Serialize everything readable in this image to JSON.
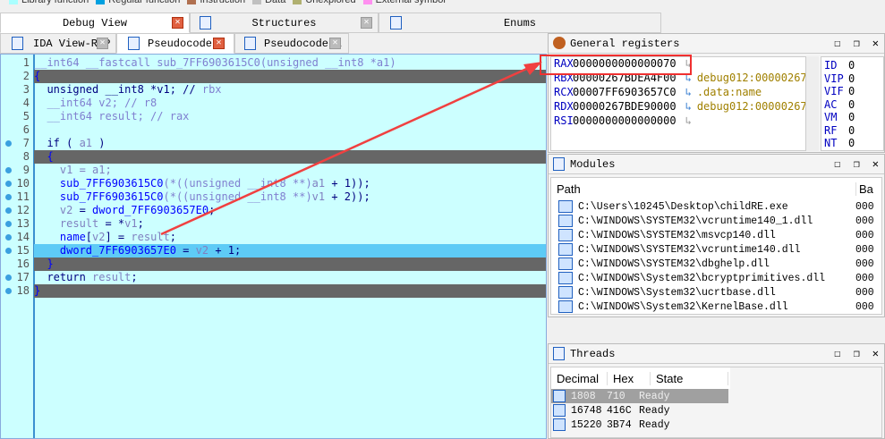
{
  "legend": [
    {
      "label": "Library function",
      "color": "#aaffff"
    },
    {
      "label": "Regular function",
      "color": "#00a0e0"
    },
    {
      "label": "Instruction",
      "color": "#b07050"
    },
    {
      "label": "Data",
      "color": "#c0c0c0"
    },
    {
      "label": "Unexplored",
      "color": "#b0b070"
    },
    {
      "label": "External symbol",
      "color": "#ff90f0"
    }
  ],
  "top_tabs": [
    {
      "label": "Debug View"
    },
    {
      "label": "Structures"
    },
    {
      "label": "Enums"
    }
  ],
  "sub_tabs": [
    {
      "label": "IDA View-RIP"
    },
    {
      "label": "Pseudocode-B"
    },
    {
      "label": "Pseudocode-A"
    }
  ],
  "code": [
    {
      "n": "1",
      "dot": false,
      "style": "",
      "seg": [
        [
          "__int64 __fastcall sub_7FF6903615C0(unsigned __int8 *a1)",
          "c"
        ]
      ]
    },
    {
      "n": "2",
      "dot": false,
      "style": "dark",
      "seg": [
        [
          "{",
          "f"
        ]
      ]
    },
    {
      "n": "3",
      "dot": false,
      "style": "",
      "seg": [
        [
          "  unsigned __int8 *v1; // ",
          "k"
        ],
        [
          "rbx",
          "c"
        ]
      ]
    },
    {
      "n": "4",
      "dot": false,
      "style": "",
      "seg": [
        [
          "  __int64 v2; // ",
          "c"
        ],
        [
          "r8",
          "c"
        ]
      ]
    },
    {
      "n": "5",
      "dot": false,
      "style": "",
      "seg": [
        [
          "  __int64 result; // ",
          "c"
        ],
        [
          "rax",
          "c"
        ]
      ]
    },
    {
      "n": "6",
      "dot": false,
      "style": "",
      "seg": [
        [
          "",
          "p"
        ]
      ]
    },
    {
      "n": "7",
      "dot": true,
      "style": "",
      "seg": [
        [
          "  if ( ",
          "k"
        ],
        [
          "a1",
          "v"
        ],
        [
          " )",
          "k"
        ]
      ]
    },
    {
      "n": "8",
      "dot": false,
      "style": "dark",
      "seg": [
        [
          "  {",
          "f"
        ]
      ]
    },
    {
      "n": "9",
      "dot": true,
      "style": "",
      "seg": [
        [
          "    v1 = a1;",
          "v"
        ]
      ]
    },
    {
      "n": "10",
      "dot": true,
      "style": "",
      "seg": [
        [
          "    sub_7FF6903615C0",
          "f"
        ],
        [
          "(*((unsigned __int8 **)",
          "c"
        ],
        [
          "a1",
          "v"
        ],
        [
          " + 1));",
          "k"
        ]
      ]
    },
    {
      "n": "11",
      "dot": true,
      "style": "",
      "seg": [
        [
          "    sub_7FF6903615C0",
          "f"
        ],
        [
          "(*((unsigned __int8 **)",
          "c"
        ],
        [
          "v1",
          "v"
        ],
        [
          " + 2));",
          "k"
        ]
      ]
    },
    {
      "n": "12",
      "dot": true,
      "style": "",
      "seg": [
        [
          "    v2",
          "v"
        ],
        [
          " = ",
          "k"
        ],
        [
          "dword_7FF6903657E0",
          "f"
        ],
        [
          ";",
          "k"
        ]
      ]
    },
    {
      "n": "13",
      "dot": true,
      "style": "",
      "seg": [
        [
          "    result",
          "v"
        ],
        [
          " = *",
          "k"
        ],
        [
          "v1",
          "v"
        ],
        [
          ";",
          "k"
        ]
      ]
    },
    {
      "n": "14",
      "dot": true,
      "style": "",
      "seg": [
        [
          "    name",
          "f"
        ],
        [
          "[",
          "k"
        ],
        [
          "v2",
          "v"
        ],
        [
          "] = ",
          "k"
        ],
        [
          "result",
          "v"
        ],
        [
          ";",
          "k"
        ]
      ]
    },
    {
      "n": "15",
      "dot": true,
      "style": "sel",
      "seg": [
        [
          "    dword_7FF6903657E0",
          "f"
        ],
        [
          " = ",
          "k"
        ],
        [
          "v2",
          "v"
        ],
        [
          " + 1;",
          "k"
        ]
      ]
    },
    {
      "n": "16",
      "dot": false,
      "style": "dark",
      "seg": [
        [
          "  }",
          "f"
        ]
      ]
    },
    {
      "n": "17",
      "dot": true,
      "style": "",
      "seg": [
        [
          "  return ",
          "k"
        ],
        [
          "result",
          "v"
        ],
        [
          ";",
          "k"
        ]
      ]
    },
    {
      "n": "18",
      "dot": true,
      "style": "dark",
      "seg": [
        [
          "}",
          "f"
        ]
      ]
    }
  ],
  "registers": {
    "title": "General registers",
    "rows": [
      {
        "name": "RAX",
        "value": "0000000000000070",
        "comment": ""
      },
      {
        "name": "RBX",
        "value": "00000267BDEA4F00",
        "comment": "debug012:00000267"
      },
      {
        "name": "RCX",
        "value": "00007FF6903657C0",
        "comment": ".data:name"
      },
      {
        "name": "RDX",
        "value": "00000267BDE90000",
        "comment": "debug012:00000267"
      },
      {
        "name": "RSI",
        "value": "0000000000000000",
        "comment": ""
      }
    ],
    "flags": [
      {
        "name": "ID",
        "value": "0"
      },
      {
        "name": "VIP",
        "value": "0"
      },
      {
        "name": "VIF",
        "value": "0"
      },
      {
        "name": "AC",
        "value": "0"
      },
      {
        "name": "VM",
        "value": "0"
      },
      {
        "name": "RF",
        "value": "0"
      },
      {
        "name": "NT",
        "value": "0"
      }
    ]
  },
  "modules": {
    "title": "Modules",
    "col_path": "Path",
    "col_base": "Ba",
    "rows": [
      {
        "path": "C:\\Users\\10245\\Desktop\\childRE.exe",
        "base": "000"
      },
      {
        "path": "C:\\WINDOWS\\SYSTEM32\\vcruntime140_1.dll",
        "base": "000"
      },
      {
        "path": "C:\\WINDOWS\\SYSTEM32\\msvcp140.dll",
        "base": "000"
      },
      {
        "path": "C:\\WINDOWS\\SYSTEM32\\vcruntime140.dll",
        "base": "000"
      },
      {
        "path": "C:\\WINDOWS\\SYSTEM32\\dbghelp.dll",
        "base": "000"
      },
      {
        "path": "C:\\WINDOWS\\System32\\bcryptprimitives.dll",
        "base": "000"
      },
      {
        "path": "C:\\WINDOWS\\System32\\ucrtbase.dll",
        "base": "000"
      },
      {
        "path": "C:\\WINDOWS\\System32\\KernelBase.dll",
        "base": "000"
      }
    ]
  },
  "threads": {
    "title": "Threads",
    "cols": [
      "Decimal",
      "Hex",
      "State"
    ],
    "rows": [
      {
        "dec": "1808",
        "hex": "710",
        "state": "Ready"
      },
      {
        "dec": "16748",
        "hex": "416C",
        "state": "Ready"
      },
      {
        "dec": "15220",
        "hex": "3B74",
        "state": "Ready"
      }
    ]
  }
}
